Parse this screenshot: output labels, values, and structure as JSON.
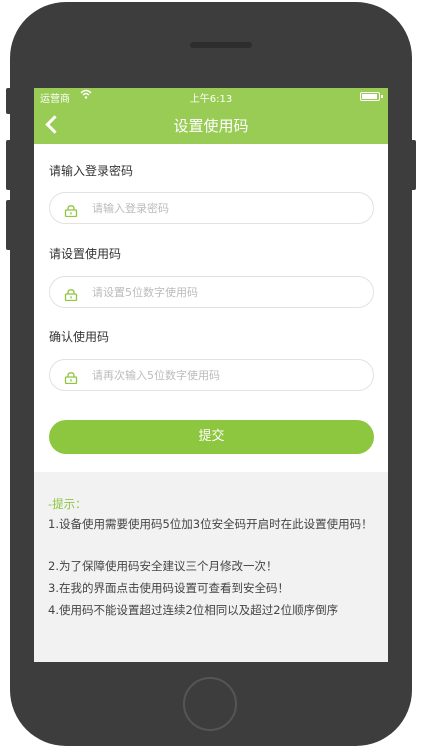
{
  "status_bar": {
    "carrier": "运营商",
    "time": "上午6:13"
  },
  "nav": {
    "title": "设置使用码"
  },
  "form": {
    "login_password": {
      "label": "请输入登录密码",
      "placeholder": "请输入登录密码"
    },
    "set_code": {
      "label": "请设置使用码",
      "placeholder": "请设置5位数字使用码"
    },
    "confirm_code": {
      "label": "确认使用码",
      "placeholder": "请再次输入5位数字使用码"
    },
    "submit_label": "提交"
  },
  "tips": {
    "title": "-提示：",
    "items": [
      "1.设备使用需要使用码5位加3位安全码开启时在此设置使用码！",
      "2.为了保障使用码安全建议三个月修改一次！",
      "3.在我的界面点击使用码设置可查看到安全码！",
      "4.使用码不能设置超过连续2位相同以及超过2位顺序倒序"
    ]
  },
  "colors": {
    "accent": "#99cc55",
    "button": "#8dc63f",
    "phone_body": "#3d3d3d",
    "tips_bg": "#f2f2f2"
  },
  "icons": [
    "back-icon",
    "wifi-icon",
    "battery-icon",
    "lock-icon"
  ]
}
